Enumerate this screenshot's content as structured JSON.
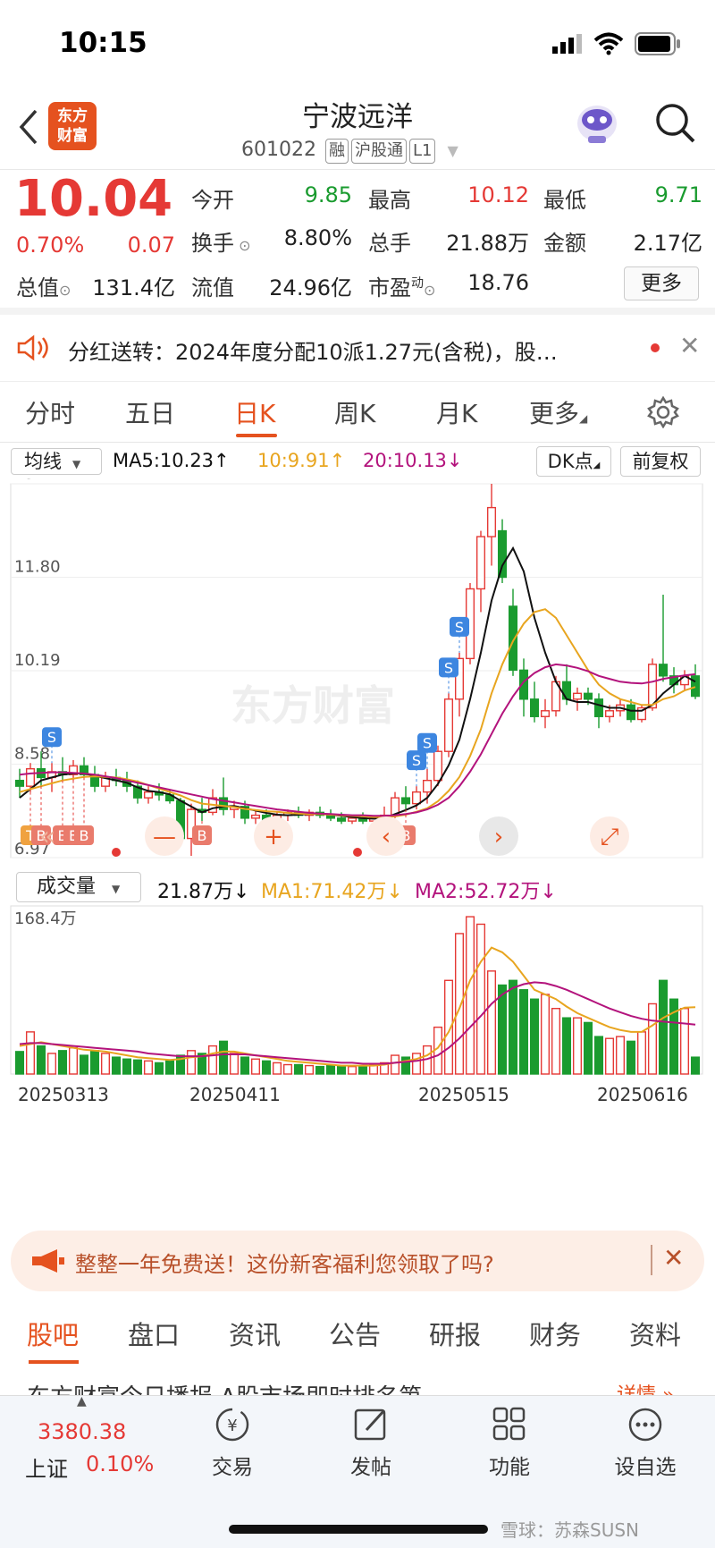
{
  "status_bar": {
    "time": "10:15"
  },
  "header": {
    "logo_text": "东方\n财富",
    "name": "宁波远洋",
    "code": "601022",
    "tags": [
      "融",
      "沪股通",
      "L1"
    ]
  },
  "quote": {
    "price": "10.04",
    "change_pct": "0.70%",
    "change": "0.07",
    "open_label": "今开",
    "open": "9.85",
    "high_label": "最高",
    "high": "10.12",
    "low_label": "最低",
    "low": "9.71",
    "turnover_label": "换手",
    "turnover": "8.80%",
    "volume_label": "总手",
    "volume": "21.88万",
    "amount_label": "金额",
    "amount": "2.17亿",
    "mktcap_label": "总值",
    "mktcap": "131.4亿",
    "float_label": "流值",
    "float": "24.96亿",
    "pe_label": "市盈",
    "pe_sup": "动",
    "pe": "18.76",
    "more_button": "更多"
  },
  "notice": {
    "text": "分红送转：2024年度分配10派1.27元(含税)，股…"
  },
  "tabs": [
    {
      "label": "分时"
    },
    {
      "label": "五日"
    },
    {
      "label": "日K"
    },
    {
      "label": "周K"
    },
    {
      "label": "月K"
    },
    {
      "label": "更多"
    }
  ],
  "chart_toolbar": {
    "indicator": "均线",
    "ma5": "MA5:10.23",
    "ma10": "10:9.91",
    "ma20": "20:10.13",
    "dk_button": "DK点",
    "adjust_button": "前复权",
    "watermark": "东方财富",
    "arrow_up": "↑",
    "arrow_down": "↓"
  },
  "volume_toolbar": {
    "indicator": "成交量",
    "vol": "21.87万",
    "ma1": "MA1:71.42万",
    "ma2": "MA2:52.72万",
    "max_label": "168.4万"
  },
  "chart_data": [
    {
      "type": "candlestick",
      "y_ticks": [
        "13.41",
        "11.80",
        "10.19",
        "8.58",
        "6.97"
      ],
      "ylim": [
        6.97,
        13.41
      ],
      "x_tick_labels": [
        "20250313",
        "20250411",
        "20250515",
        "20250616"
      ],
      "series_labels": [
        "MA5:10.23",
        "10:9.91",
        "20:10.13"
      ],
      "candles": [
        [
          8.3,
          8.5,
          8.0,
          8.2
        ],
        [
          8.2,
          8.6,
          8.1,
          8.5
        ],
        [
          8.5,
          8.8,
          8.2,
          8.35
        ],
        [
          8.35,
          8.6,
          8.1,
          8.45
        ],
        [
          8.45,
          8.7,
          8.3,
          8.4
        ],
        [
          8.4,
          8.65,
          8.3,
          8.55
        ],
        [
          8.55,
          8.7,
          8.35,
          8.4
        ],
        [
          8.4,
          8.55,
          8.1,
          8.2
        ],
        [
          8.2,
          8.45,
          8.1,
          8.35
        ],
        [
          8.35,
          8.5,
          8.2,
          8.3
        ],
        [
          8.3,
          8.45,
          8.1,
          8.2
        ],
        [
          8.2,
          8.3,
          7.9,
          8.0
        ],
        [
          8.0,
          8.2,
          7.9,
          8.1
        ],
        [
          8.1,
          8.25,
          7.95,
          8.05
        ],
        [
          8.05,
          8.15,
          7.9,
          7.95
        ],
        [
          7.95,
          8.0,
          7.2,
          7.3
        ],
        [
          7.3,
          7.9,
          7.0,
          7.8
        ],
        [
          7.8,
          8.0,
          7.6,
          7.75
        ],
        [
          7.75,
          8.15,
          7.7,
          8.0
        ],
        [
          8.0,
          8.35,
          7.7,
          7.8
        ],
        [
          7.8,
          7.95,
          7.65,
          7.85
        ],
        [
          7.85,
          7.95,
          7.55,
          7.65
        ],
        [
          7.65,
          7.8,
          7.55,
          7.7
        ],
        [
          7.7,
          7.8,
          7.55,
          7.6
        ],
        [
          7.6,
          7.75,
          7.5,
          7.7
        ],
        [
          7.7,
          7.8,
          7.6,
          7.75
        ],
        [
          7.75,
          7.85,
          7.65,
          7.7
        ],
        [
          7.7,
          7.8,
          7.6,
          7.75
        ],
        [
          7.75,
          7.85,
          7.65,
          7.7
        ],
        [
          7.7,
          7.8,
          7.6,
          7.65
        ],
        [
          7.65,
          7.75,
          7.55,
          7.6
        ],
        [
          7.6,
          7.7,
          7.55,
          7.65
        ],
        [
          7.65,
          7.75,
          7.55,
          7.6
        ],
        [
          7.6,
          7.7,
          7.55,
          7.65
        ],
        [
          7.65,
          7.85,
          7.6,
          7.7
        ],
        [
          7.7,
          8.1,
          7.65,
          8.0
        ],
        [
          8.0,
          8.2,
          7.8,
          7.9
        ],
        [
          7.9,
          8.2,
          7.8,
          8.1
        ],
        [
          8.1,
          8.5,
          7.9,
          8.3
        ],
        [
          8.3,
          8.9,
          8.2,
          8.8
        ],
        [
          8.8,
          9.8,
          8.7,
          9.7
        ],
        [
          9.7,
          10.5,
          9.4,
          10.4
        ],
        [
          10.4,
          11.7,
          10.3,
          11.6
        ],
        [
          11.6,
          12.6,
          11.2,
          12.5
        ],
        [
          12.5,
          13.41,
          12.0,
          13.0
        ],
        [
          12.6,
          12.8,
          11.7,
          11.8
        ],
        [
          11.3,
          11.6,
          10.1,
          10.2
        ],
        [
          10.2,
          10.4,
          9.4,
          9.7
        ],
        [
          9.7,
          10.0,
          9.3,
          9.4
        ],
        [
          9.4,
          9.7,
          9.2,
          9.5
        ],
        [
          9.5,
          10.1,
          9.4,
          10.0
        ],
        [
          10.0,
          10.3,
          9.6,
          9.7
        ],
        [
          9.7,
          9.9,
          9.5,
          9.8
        ],
        [
          9.8,
          9.9,
          9.6,
          9.7
        ],
        [
          9.7,
          9.8,
          9.2,
          9.4
        ],
        [
          9.4,
          9.6,
          9.3,
          9.5
        ],
        [
          9.5,
          9.7,
          9.4,
          9.6
        ],
        [
          9.6,
          9.7,
          9.3,
          9.35
        ],
        [
          9.35,
          9.6,
          9.3,
          9.55
        ],
        [
          9.55,
          10.4,
          9.5,
          10.3
        ],
        [
          10.3,
          11.5,
          10.0,
          10.1
        ],
        [
          10.1,
          10.25,
          9.8,
          9.95
        ],
        [
          9.95,
          10.2,
          9.85,
          10.1
        ],
        [
          10.1,
          10.3,
          9.7,
          9.75
        ]
      ],
      "ma_series": [
        {
          "name": "MA5",
          "color": "#111111",
          "values": [
            8.0,
            8.15,
            8.3,
            8.35,
            8.4,
            8.42,
            8.42,
            8.38,
            8.34,
            8.3,
            8.26,
            8.18,
            8.12,
            8.1,
            8.06,
            7.95,
            7.85,
            7.75,
            7.82,
            7.85,
            7.86,
            7.82,
            7.78,
            7.74,
            7.71,
            7.7,
            7.71,
            7.72,
            7.72,
            7.71,
            7.69,
            7.67,
            7.65,
            7.64,
            7.65,
            7.72,
            7.79,
            7.87,
            8.0,
            8.24,
            8.56,
            9.0,
            9.7,
            10.5,
            11.4,
            12.0,
            12.3,
            11.9,
            11.1,
            10.5,
            10.0,
            9.7,
            9.65,
            9.65,
            9.6,
            9.55,
            9.55,
            9.5,
            9.5,
            9.6,
            9.8,
            9.95,
            10.1,
            10.0
          ]
        },
        {
          "name": "MA10",
          "color": "#e8a51f",
          "values": [
            8.1,
            8.15,
            8.2,
            8.25,
            8.3,
            8.33,
            8.36,
            8.37,
            8.36,
            8.35,
            8.32,
            8.28,
            8.22,
            8.16,
            8.1,
            8.04,
            7.96,
            7.9,
            7.88,
            7.86,
            7.84,
            7.81,
            7.79,
            7.77,
            7.76,
            7.74,
            7.73,
            7.72,
            7.72,
            7.71,
            7.7,
            7.69,
            7.68,
            7.67,
            7.67,
            7.68,
            7.71,
            7.76,
            7.82,
            7.94,
            8.12,
            8.36,
            8.72,
            9.18,
            9.8,
            10.3,
            10.7,
            11.0,
            11.2,
            11.25,
            11.1,
            10.8,
            10.5,
            10.2,
            9.95,
            9.8,
            9.7,
            9.65,
            9.6,
            9.6,
            9.7,
            9.75,
            9.85,
            9.91
          ]
        },
        {
          "name": "MA20",
          "color": "#b3137c",
          "values": [
            8.4,
            8.42,
            8.43,
            8.44,
            8.44,
            8.43,
            8.42,
            8.4,
            8.37,
            8.34,
            8.3,
            8.26,
            8.22,
            8.18,
            8.14,
            8.1,
            8.06,
            8.02,
            7.98,
            7.95,
            7.92,
            7.89,
            7.86,
            7.83,
            7.8,
            7.78,
            7.76,
            7.74,
            7.73,
            7.72,
            7.71,
            7.7,
            7.7,
            7.69,
            7.69,
            7.7,
            7.72,
            7.75,
            7.8,
            7.88,
            8.0,
            8.2,
            8.45,
            8.75,
            9.1,
            9.45,
            9.75,
            10.0,
            10.15,
            10.25,
            10.3,
            10.28,
            10.24,
            10.18,
            10.1,
            10.05,
            10.0,
            9.98,
            9.97,
            10.0,
            10.05,
            10.08,
            10.11,
            10.13
          ]
        }
      ]
    },
    {
      "type": "bar",
      "title": "成交量",
      "y_max_label": "168.4万",
      "values": [
        24,
        45,
        30,
        22,
        25,
        28,
        20,
        25,
        22,
        18,
        16,
        15,
        14,
        12,
        14,
        20,
        25,
        22,
        30,
        35,
        22,
        18,
        16,
        14,
        12,
        10,
        10,
        9,
        8,
        9,
        8,
        8,
        9,
        10,
        12,
        20,
        18,
        22,
        30,
        50,
        100,
        150,
        168,
        160,
        110,
        95,
        100,
        90,
        80,
        85,
        70,
        60,
        60,
        55,
        40,
        38,
        40,
        35,
        45,
        75,
        100,
        80,
        70,
        18
      ],
      "ma1": [
        30,
        32,
        34,
        32,
        30,
        28,
        26,
        25,
        24,
        22,
        20,
        18,
        17,
        16,
        15,
        16,
        18,
        19,
        22,
        24,
        24,
        22,
        20,
        18,
        16,
        14,
        13,
        12,
        11,
        10,
        9,
        9,
        9,
        9,
        10,
        12,
        14,
        16,
        20,
        28,
        45,
        70,
        100,
        120,
        135,
        130,
        120,
        105,
        90,
        85,
        80,
        72,
        65,
        60,
        55,
        50,
        47,
        45,
        45,
        52,
        60,
        66,
        71,
        71.42
      ],
      "ma2": [
        32,
        33,
        33,
        32,
        31,
        30,
        29,
        28,
        27,
        26,
        25,
        24,
        22,
        21,
        20,
        19,
        19,
        19,
        20,
        21,
        21,
        21,
        20,
        19,
        18,
        17,
        16,
        15,
        14,
        13,
        12,
        12,
        11,
        11,
        11,
        12,
        13,
        14,
        16,
        20,
        28,
        38,
        50,
        62,
        75,
        85,
        92,
        96,
        98,
        97,
        94,
        90,
        85,
        80,
        75,
        70,
        66,
        62,
        59,
        57,
        56,
        55,
        54,
        52.72
      ]
    }
  ],
  "chart_controls": {
    "minus": "—",
    "plus": "+",
    "prev": "‹",
    "next": "›",
    "expand": "⤢"
  },
  "signal_markers": [
    {
      "label": "S",
      "i": 3
    },
    {
      "label": "T",
      "i": 1
    },
    {
      "label": "B",
      "i": 2
    },
    {
      "label": "B",
      "i": 4
    },
    {
      "label": "E",
      "i": 5
    },
    {
      "label": "B",
      "i": 6
    },
    {
      "label": "B",
      "i": 17
    },
    {
      "label": "S",
      "i": 37
    },
    {
      "label": "S",
      "i": 38
    },
    {
      "label": "S",
      "i": 40
    },
    {
      "label": "S",
      "i": 41
    },
    {
      "label": "B",
      "i": 36
    }
  ],
  "banner": {
    "text": "整整一年免费送！这份新客福利您领取了吗?",
    "close": "✕"
  },
  "bottom_tabs": [
    "股吧",
    "盘口",
    "资讯",
    "公告",
    "研报",
    "财务",
    "资料"
  ],
  "hidden_row": {
    "text": "东方财富今日播报  A股市场即时排名第",
    "more": "详情 »"
  },
  "dock": {
    "index_value": "3380.38",
    "index_name": "上证",
    "index_change": "0.10%",
    "items": [
      {
        "label": "交易"
      },
      {
        "label": "发帖"
      },
      {
        "label": "功能"
      },
      {
        "label": "设自选"
      }
    ]
  },
  "watermark_footer": "雪球：苏森SUSN"
}
